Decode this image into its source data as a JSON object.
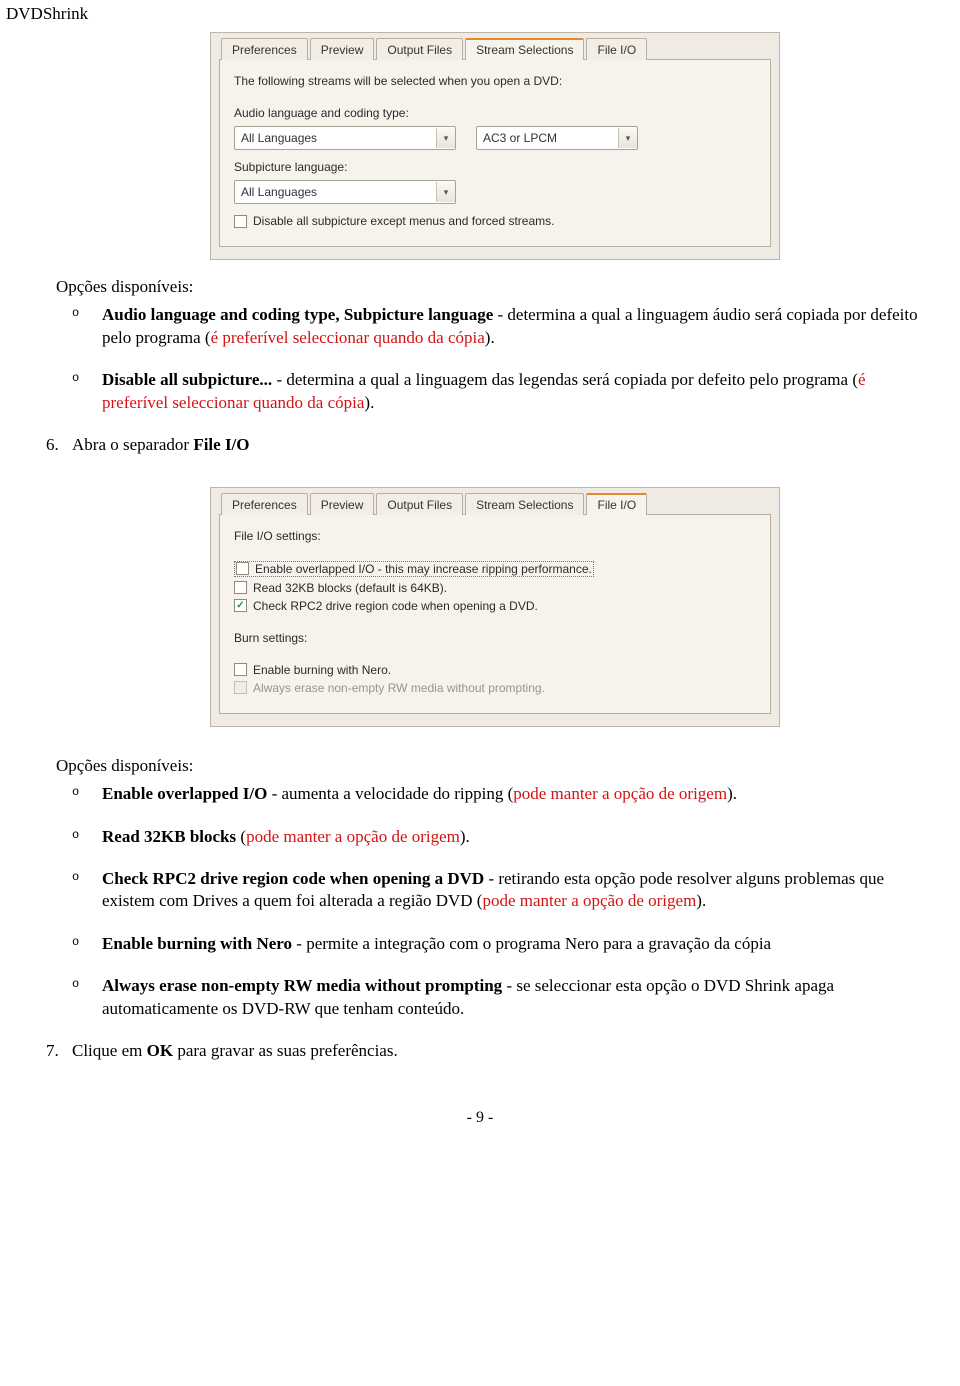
{
  "page_title": "DVDShrink",
  "dialog1": {
    "tabs": [
      "Preferences",
      "Preview",
      "Output Files",
      "Stream Selections",
      "File I/O"
    ],
    "active_tab_index": 3,
    "intro": "The following streams will be selected when you open a DVD:",
    "label_audio": "Audio language and coding type:",
    "combo_lang_value": "All Languages",
    "combo_codec_value": "AC3 or LPCM",
    "label_subpic": "Subpicture language:",
    "combo_subpic_value": "All Languages",
    "chk_disable": "Disable all subpicture except menus and forced streams."
  },
  "section1": {
    "heading": "Opções disponíveis:",
    "items": [
      {
        "bold": "Audio language and coding type, Subpicture language",
        "text_mid": " - determina a qual a linguagem áudio será copiada por defeito pelo programa (",
        "red": "é preferível seleccionar quando da cópia",
        "text_end": ")."
      },
      {
        "bold": "Disable all subpicture...",
        "text_mid": " - determina a qual a linguagem das legendas será copiada por defeito pelo programa (",
        "red": "é preferível seleccionar quando da cópia",
        "text_end": ")."
      }
    ]
  },
  "step6": {
    "num": "6.",
    "text1": "Abra o separador ",
    "bold": "File I/O"
  },
  "dialog2": {
    "tabs": [
      "Preferences",
      "Preview",
      "Output Files",
      "Stream Selections",
      "File I/O"
    ],
    "active_tab_index": 4,
    "label_fio": "File I/O settings:",
    "chk_overlapped": "Enable overlapped I/O - this may increase ripping performance.",
    "chk_32kb": "Read 32KB blocks (default is 64KB).",
    "chk_rpc2": "Check RPC2 drive region code when opening a DVD.",
    "label_burn": "Burn settings:",
    "chk_nero": "Enable burning with Nero.",
    "chk_erase": "Always erase non-empty RW media without prompting."
  },
  "section2": {
    "heading": "Opções disponíveis:",
    "items": [
      {
        "bold": "Enable overlapped I/O",
        "mid": " - aumenta a velocidade do ripping (",
        "red": "pode manter a opção de origem",
        "end": ")."
      },
      {
        "bold": "Read 32KB blocks ",
        "mid": " (",
        "red": "pode manter a opção de origem",
        "end": ")."
      },
      {
        "bold": "Check RPC2 drive region code when opening a DVD",
        "mid": " - retirando esta opção pode resolver alguns problemas que existem com Drives a quem foi alterada a região DVD (",
        "red": "pode manter a opção de origem",
        "end": ")."
      },
      {
        "bold": "Enable burning with Nero",
        "mid": " - permite a integração com o programa Nero para a gravação da cópia",
        "red": "",
        "end": ""
      },
      {
        "bold": "Always erase non-empty RW media without prompting",
        "mid": " - se seleccionar esta opção o DVD Shrink apaga automaticamente os DVD-RW que tenham conteúdo.",
        "red": "",
        "end": ""
      }
    ]
  },
  "step7": {
    "num": "7.",
    "text1": "Clique em ",
    "bold": "OK",
    "text2": " para gravar as suas preferências."
  },
  "footer": "- 9 -"
}
